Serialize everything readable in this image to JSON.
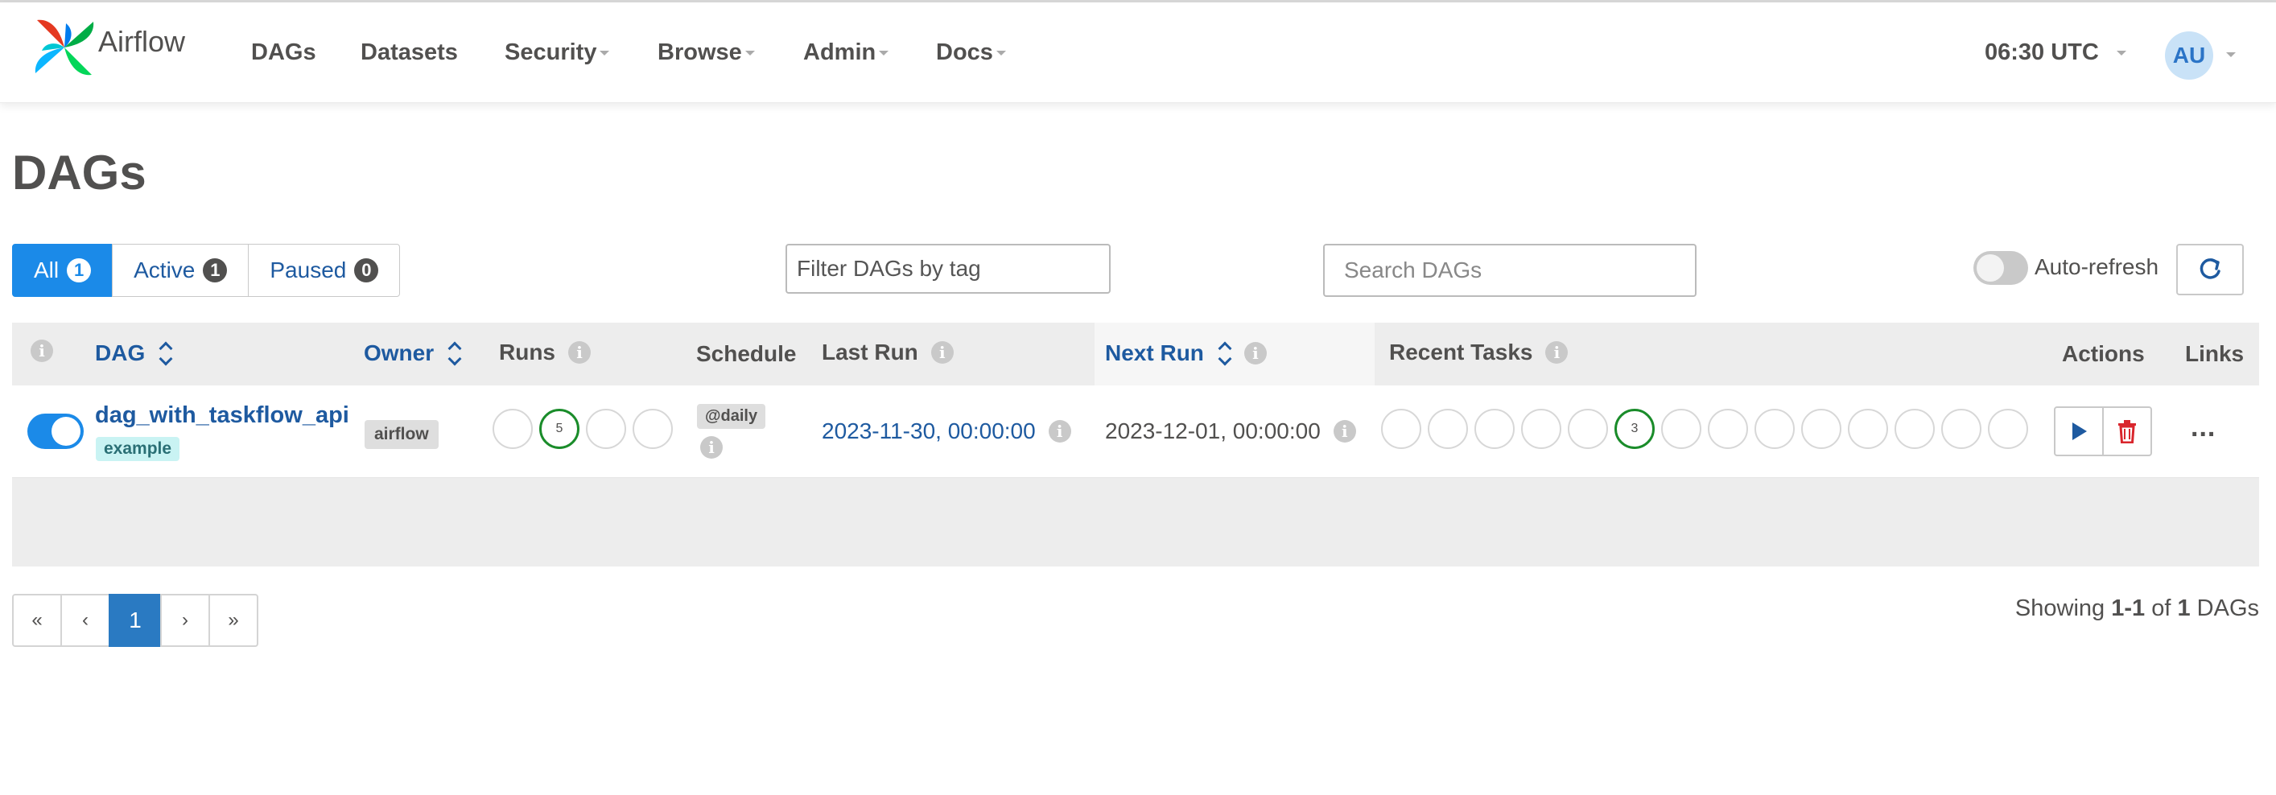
{
  "brand": {
    "name": "Airflow"
  },
  "nav": {
    "items": [
      {
        "label": "DAGs"
      },
      {
        "label": "Datasets"
      },
      {
        "label": "Security"
      },
      {
        "label": "Browse"
      },
      {
        "label": "Admin"
      },
      {
        "label": "Docs"
      }
    ],
    "time": "06:30 UTC",
    "user_initials": "AU"
  },
  "page": {
    "title": "DAGs"
  },
  "filters": {
    "all": {
      "label": "All",
      "count": "1"
    },
    "active": {
      "label": "Active",
      "count": "1"
    },
    "paused": {
      "label": "Paused",
      "count": "0"
    },
    "tag_placeholder": "Filter DAGs by tag",
    "search_placeholder": "Search DAGs",
    "auto_refresh_label": "Auto-refresh"
  },
  "table": {
    "headers": {
      "dag": "DAG",
      "owner": "Owner",
      "runs": "Runs",
      "schedule": "Schedule",
      "last_run": "Last Run",
      "next_run": "Next Run",
      "recent_tasks": "Recent Tasks",
      "actions": "Actions",
      "links": "Links"
    },
    "rows": [
      {
        "dag_id": "dag_with_taskflow_api",
        "tag": "example",
        "owner": "airflow",
        "runs": [
          "",
          "5",
          "",
          ""
        ],
        "schedule": "@daily",
        "last_run": "2023-11-30, 00:00:00",
        "next_run": "2023-12-01, 00:00:00",
        "recent_tasks": [
          "",
          "",
          "",
          "",
          "",
          "3",
          "",
          "",
          "",
          "",
          "",
          "",
          "",
          ""
        ],
        "links_label": "..."
      }
    ]
  },
  "pagination": {
    "first": "«",
    "prev": "‹",
    "current": "1",
    "next": "›",
    "last": "»",
    "showing_prefix": "Showing",
    "showing_range": "1-1",
    "showing_of": "of",
    "showing_total": "1",
    "showing_suffix": "DAGs"
  },
  "colors": {
    "primary": "#1b8ae8",
    "link": "#1e5aa0",
    "success": "#1a8c2a",
    "danger": "#d9262d"
  }
}
